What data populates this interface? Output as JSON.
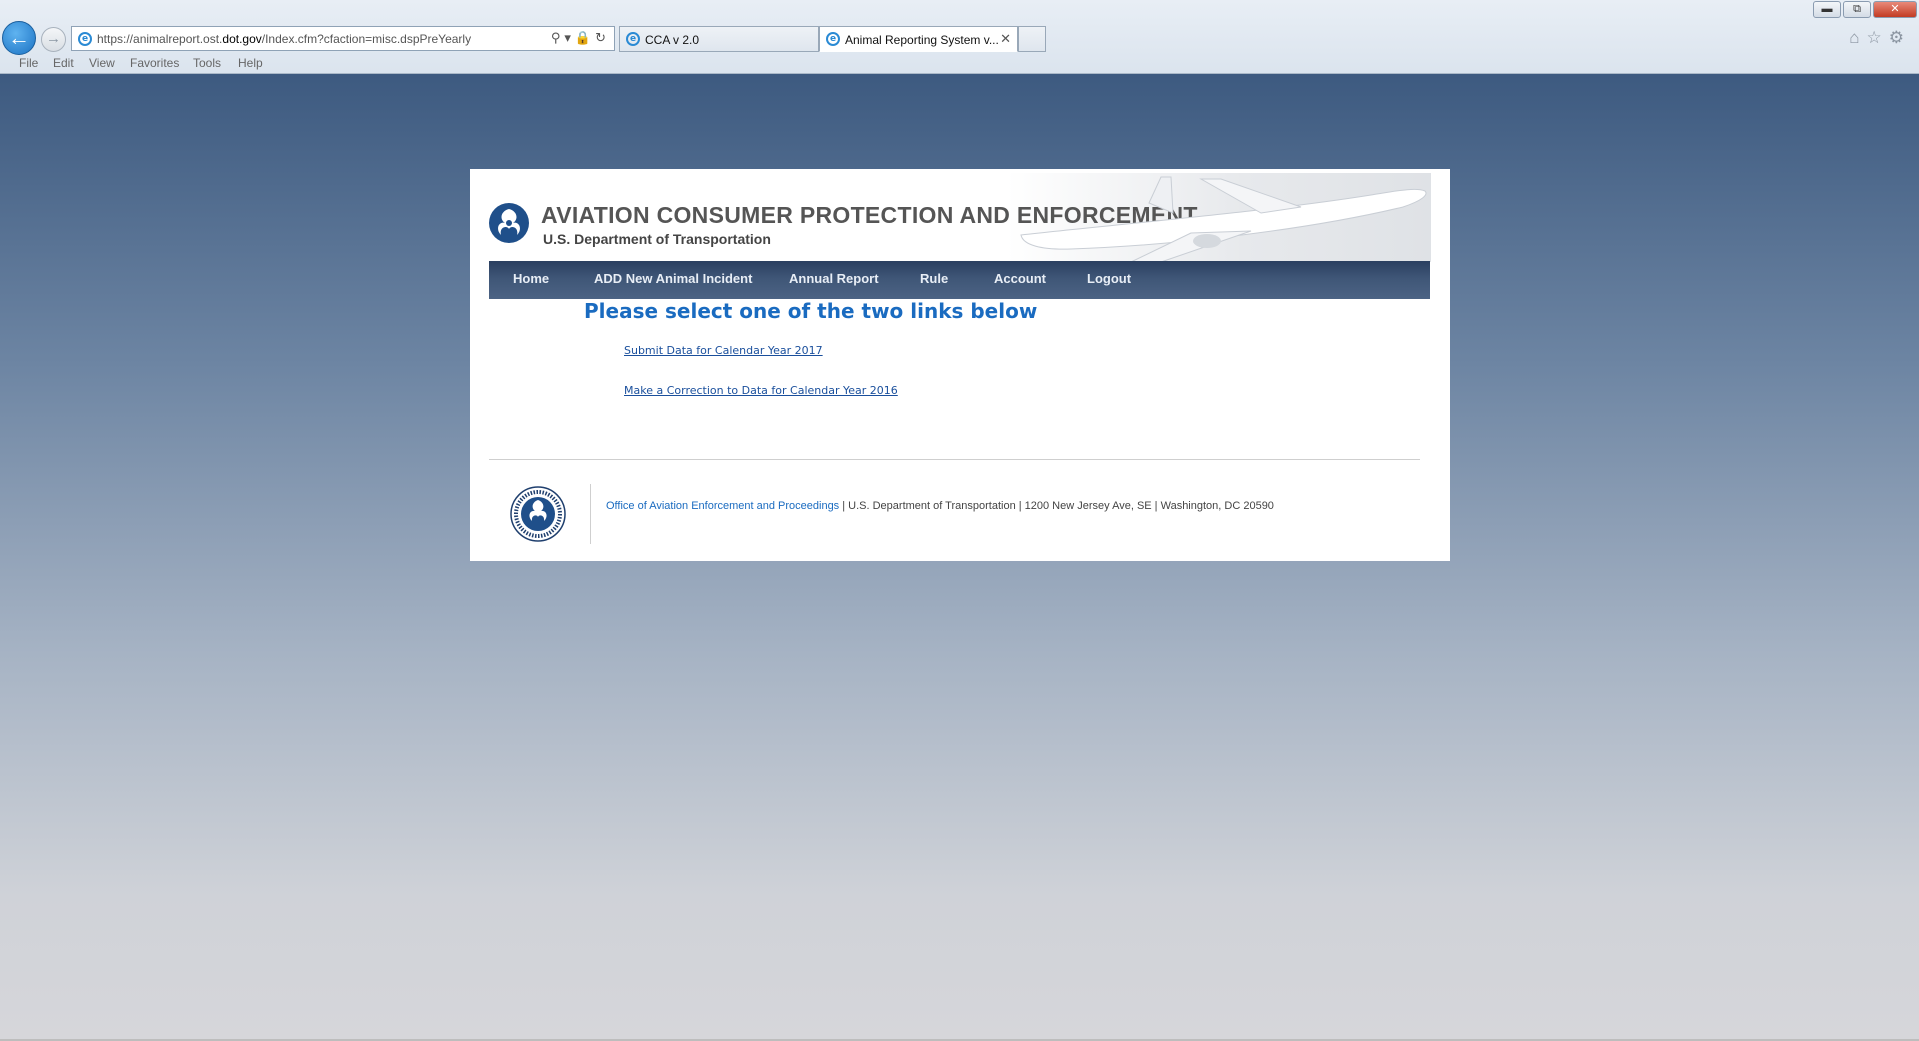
{
  "browser": {
    "url_prefix": "https://animalreport.ost.",
    "url_domain": "dot.gov",
    "url_path": "/Index.cfm?cfaction=misc.dspPreYearly",
    "tabs": [
      {
        "label": "CCA v 2.0"
      },
      {
        "label": "Animal Reporting System v..."
      }
    ],
    "menu": [
      "File",
      "Edit",
      "View",
      "Favorites",
      "Tools",
      "Help"
    ]
  },
  "header": {
    "title": "AVIATION CONSUMER PROTECTION AND ENFORCEMENT",
    "subtitle": "U.S. Department of Transportation"
  },
  "nav": {
    "items": [
      "Home",
      "ADD New Animal Incident",
      "Annual Report",
      "Rule",
      "Account",
      "Logout"
    ]
  },
  "main": {
    "heading": "Please select one of the two links below",
    "links": [
      "Submit Data for Calendar Year 2017",
      "Make a Correction to Data for Calendar Year 2016"
    ]
  },
  "footer": {
    "office_link": "Office of Aviation Enforcement and Proceedings",
    "address": " | U.S. Department of Transportation | 1200 New Jersey Ave, SE | Washington, DC 20590"
  },
  "colors": {
    "navbar": "#3f5677",
    "heading": "#1a6bc0",
    "link": "#1a4f9c",
    "background_top": "#3d5a80"
  }
}
